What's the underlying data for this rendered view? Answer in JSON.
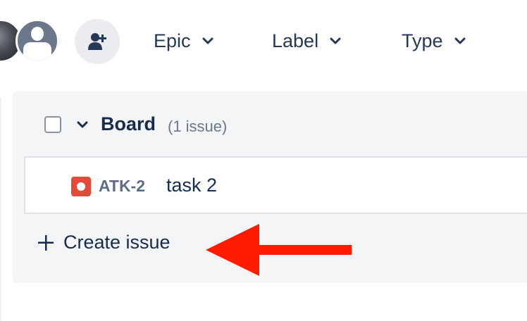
{
  "filters": [
    {
      "label": "Epic",
      "icon": "chevron-down-icon"
    },
    {
      "label": "Label",
      "icon": "chevron-down-icon"
    },
    {
      "label": "Type",
      "icon": "chevron-down-icon"
    }
  ],
  "group": {
    "title": "Board",
    "count": "(1 issue)"
  },
  "issues": [
    {
      "key": "ATK-2",
      "summary": "task 2",
      "type_icon": "bug-icon"
    }
  ],
  "create_issue": {
    "label": "Create issue",
    "icon": "plus-icon"
  },
  "colors": {
    "text": "#172b4d",
    "panel": "#f4f5f7",
    "bug": "#e5493a",
    "annotation_arrow": "#ff1a00"
  }
}
